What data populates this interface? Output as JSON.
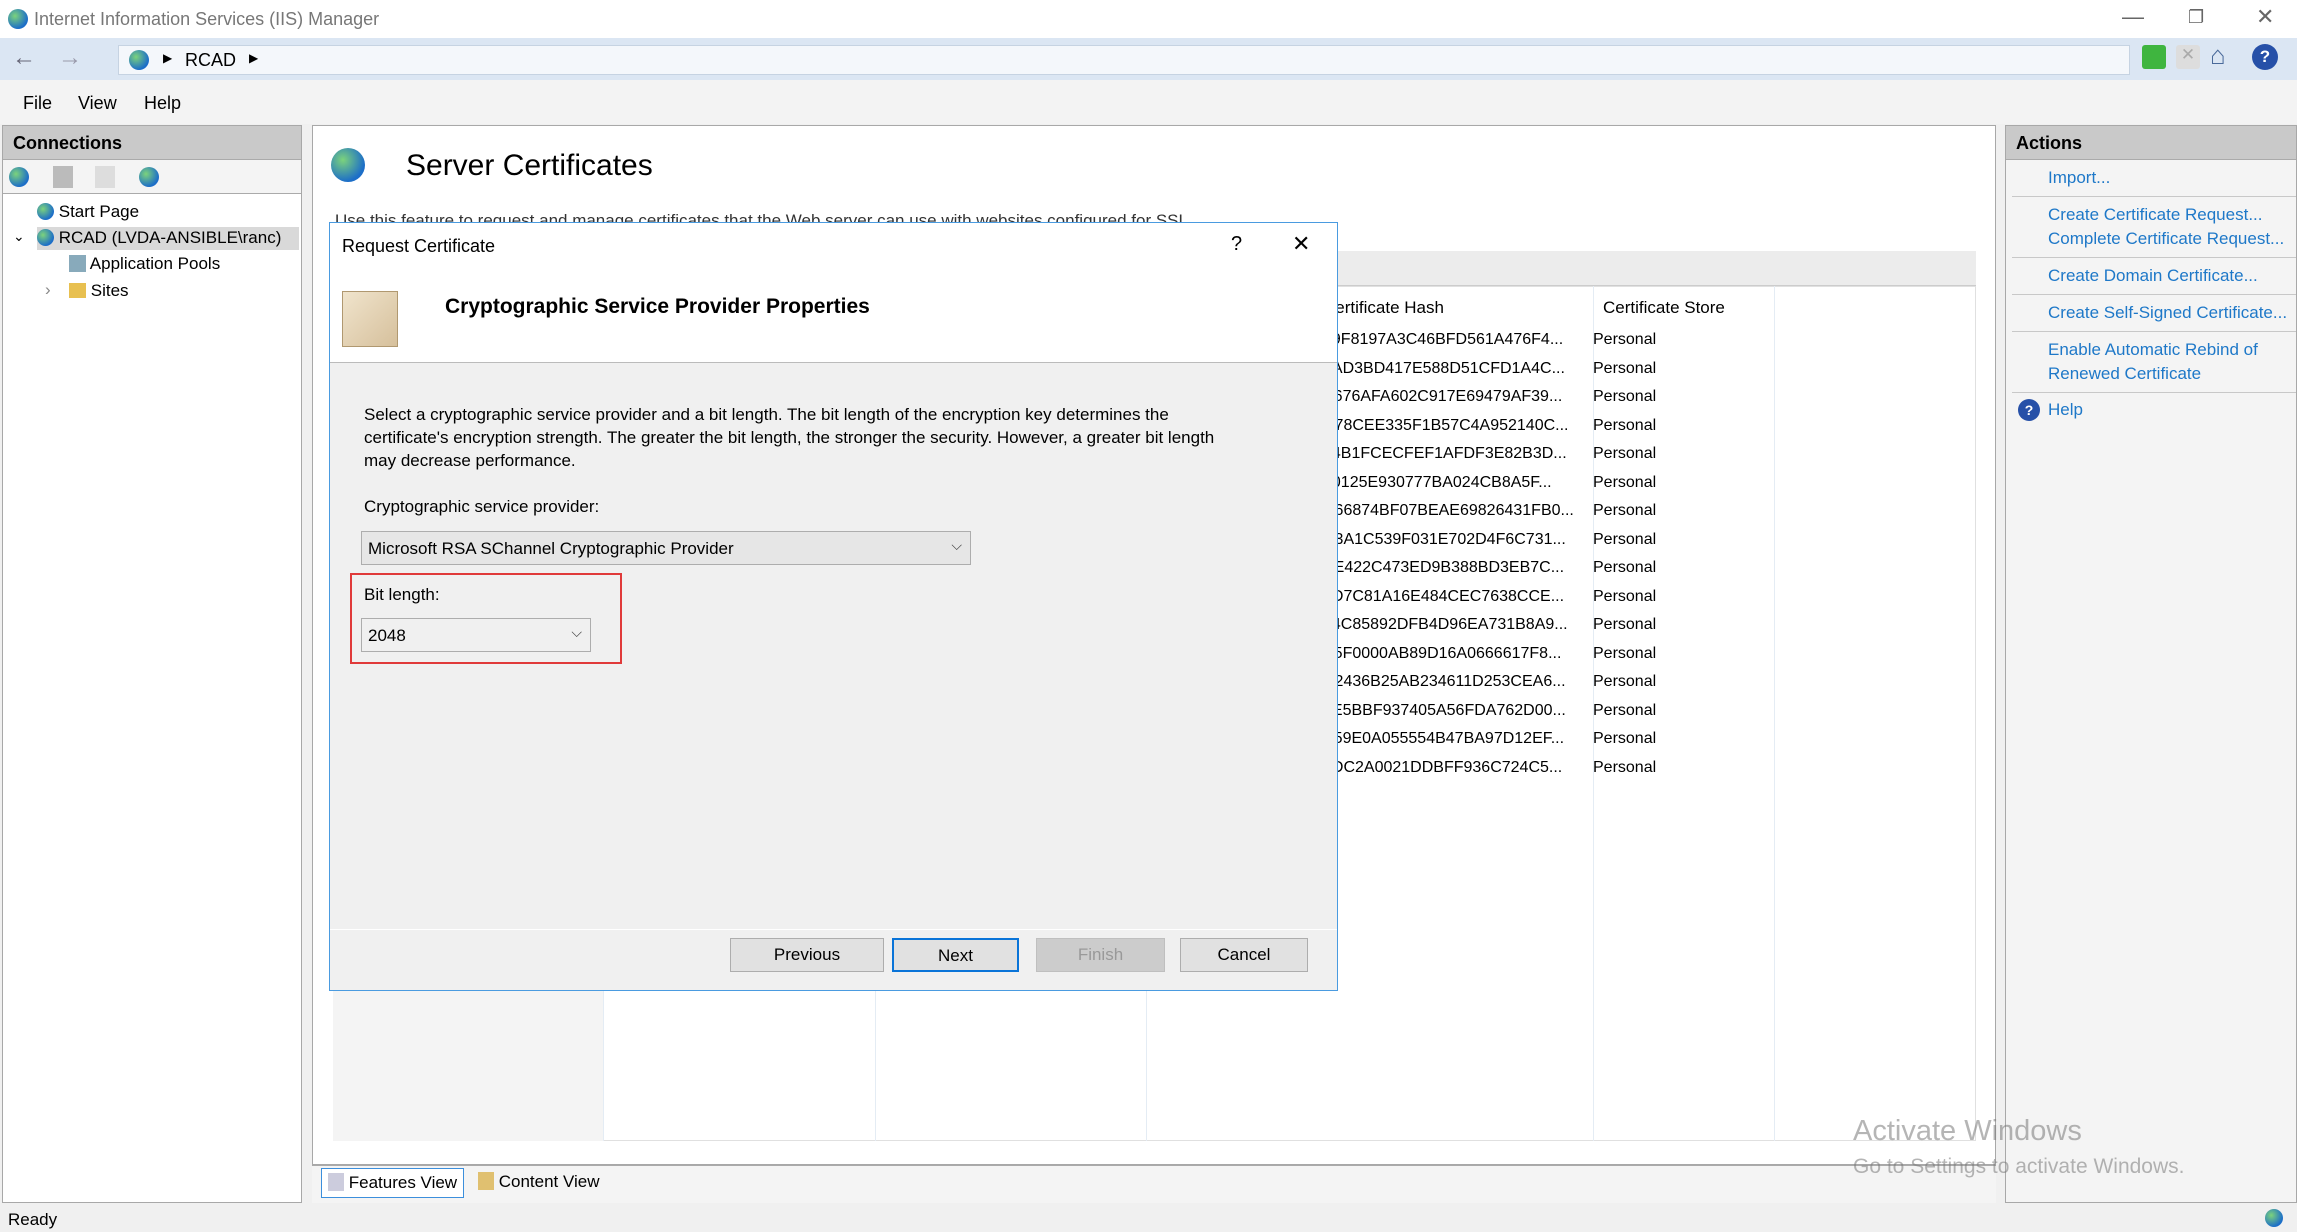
{
  "window": {
    "title": "Internet Information Services (IIS) Manager"
  },
  "address": {
    "crumbs": [
      "RCAD"
    ]
  },
  "menu": [
    "File",
    "View",
    "Help"
  ],
  "connections": {
    "title": "Connections",
    "tree": [
      {
        "label": "Start Page"
      },
      {
        "label": "RCAD (LVDA-ANSIBLE\\ranc)",
        "selected": true,
        "expanded": true
      },
      {
        "label": "Application Pools"
      },
      {
        "label": "Sites",
        "collapsed": true
      }
    ]
  },
  "main": {
    "title": "Server Certificates",
    "description": "Use this feature to request and manage certificates that the Web server can use with websites configured for SSL.",
    "columns": [
      "Certificate Hash",
      "Certificate Store"
    ],
    "rows": [
      [
        "09F8197A3C46BFD561A476F4...",
        "Personal"
      ],
      [
        "0AD3BD417E588D51CFD1A4C...",
        "Personal"
      ],
      [
        "A676AFA602C917E69479AF39...",
        "Personal"
      ],
      [
        "D78CEE335F1B57C4A952140C...",
        "Personal"
      ],
      [
        "34B1FCECFEF1AFDF3E82B3D...",
        "Personal"
      ],
      [
        "00125E930777BA024CB8A5F...",
        "Personal"
      ],
      [
        "C66874BF07BEAE69826431FB0...",
        "Personal"
      ],
      [
        "D3A1C539F031E702D4F6C731...",
        "Personal"
      ],
      [
        "EE422C473ED9B388BD3EB7C...",
        "Personal"
      ],
      [
        "3D7C81A16E484CEC7638CCE...",
        "Personal"
      ],
      [
        "64C85892DFB4D96EA731B8A9...",
        "Personal"
      ],
      [
        "A5F0000AB89D16A0666617F8...",
        "Personal"
      ],
      [
        "D2436B25AB234611D253CEA6...",
        "Personal"
      ],
      [
        "9E5BBF937405A56FDA762D00...",
        "Personal"
      ],
      [
        "A59E0A055554B47BA97D12EF...",
        "Personal"
      ],
      [
        "3DC2A0021DDBFF936C724C5...",
        "Personal"
      ]
    ],
    "views": [
      "Features View",
      "Content View"
    ]
  },
  "dialog": {
    "title": "Request Certificate",
    "help": "?",
    "heading": "Cryptographic Service Provider Properties",
    "description": "Select a cryptographic service provider and a bit length. The bit length of the encryption key determines the certificate's encryption strength. The greater the bit length, the stronger the security. However, a greater bit length may decrease performance.",
    "provider_label": "Cryptographic service provider:",
    "provider_value": "Microsoft RSA SChannel Cryptographic Provider",
    "bit_label": "Bit length:",
    "bit_value": "2048",
    "buttons": {
      "previous": "Previous",
      "next": "Next",
      "finish": "Finish",
      "cancel": "Cancel"
    },
    "highlight_color": "#e03a3a"
  },
  "actions": {
    "title": "Actions",
    "items": [
      "Import...",
      "Create Certificate Request...",
      "Complete Certificate Request...",
      "Create Domain Certificate...",
      "Create Self-Signed Certificate...",
      "Enable Automatic Rebind of Renewed Certificate"
    ],
    "help": "Help"
  },
  "status": {
    "text": "Ready"
  },
  "watermark": {
    "line1": "Activate Windows",
    "line2": "Go to Settings to activate Windows."
  }
}
